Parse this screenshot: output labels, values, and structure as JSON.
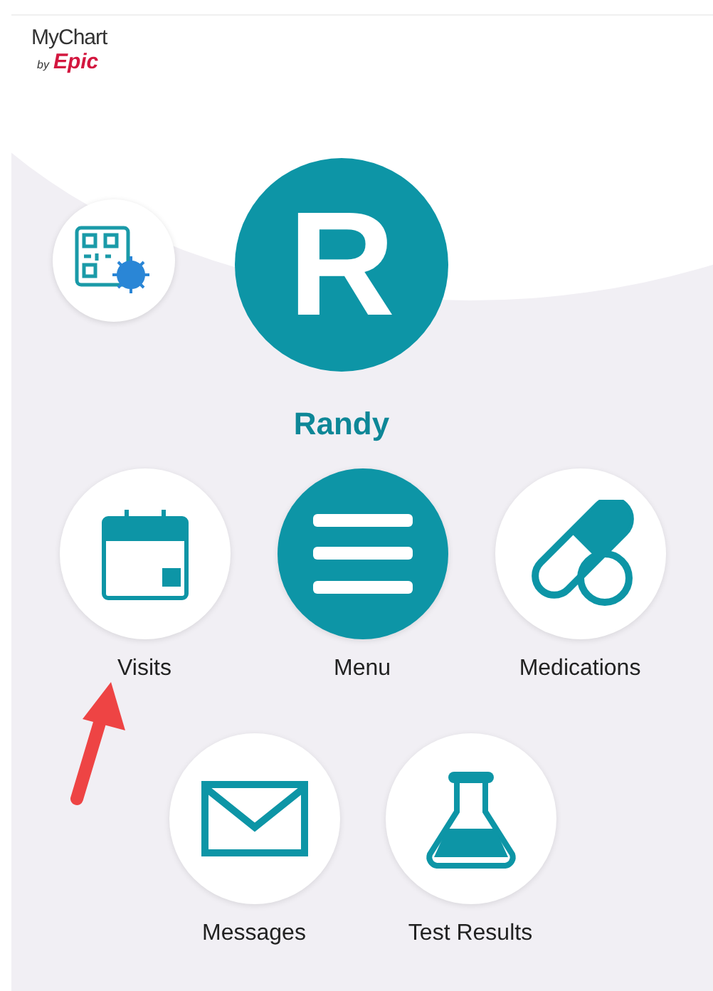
{
  "logo": {
    "name": "MyChart",
    "by": "by",
    "brand": "Epic"
  },
  "profile": {
    "initial": "R",
    "name": "Randy"
  },
  "tile_rows": [
    [
      {
        "label": "Visits",
        "kind": "calendar",
        "filled": false
      },
      {
        "label": "Menu",
        "kind": "menu",
        "filled": true
      },
      {
        "label": "Medications",
        "kind": "pills",
        "filled": false
      }
    ],
    [
      {
        "label": "Messages",
        "kind": "envelope",
        "filled": false
      },
      {
        "label": "Test Results",
        "kind": "flask",
        "filled": false
      }
    ]
  ]
}
